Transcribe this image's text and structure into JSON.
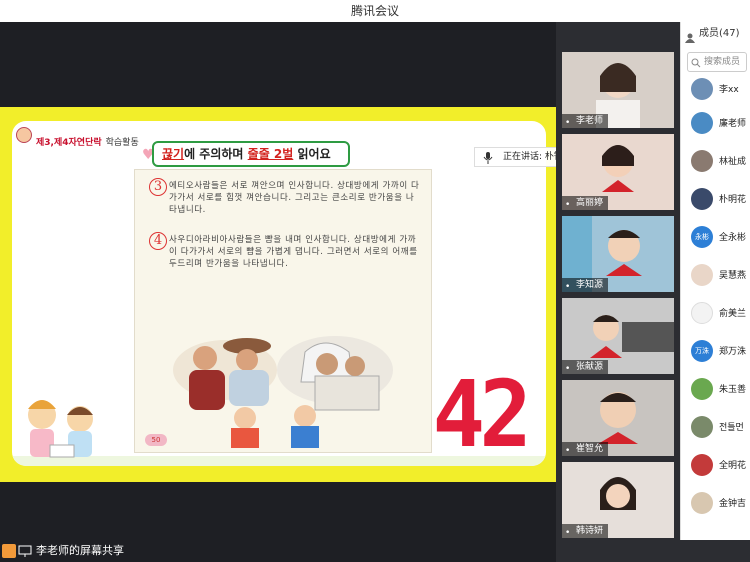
{
  "window": {
    "title": "腾讯会议"
  },
  "slide": {
    "lesson_badge": "제3,제4자연단락",
    "lesson_sub": "학습활동",
    "instruction_red1": "끊기",
    "instruction_mid": "에 주의하며 ",
    "instruction_red2": "줄줄 2벌",
    "instruction_end": " 읽어요",
    "para3_num": "3",
    "para3_text": "에티오사람들은 서로 껴안으며 인사합니다. 상대방에게 가까이 다가가서 서로를 힘껏 껴안습니다. 그리고는 큰소리로 반가움을 나타냅니다.",
    "para4_num": "4",
    "para4_text": "사우디아라비아사람들은 뺨을 내며 인사합니다. 상대방에게 가까이 다가가서 서로의 뺨을 가볍게 댑니다. 그러면서 서로의 어깨를 두드리며 반가움을 나타냅니다.",
    "page_number": "50",
    "timer": "42"
  },
  "speaking": {
    "label": "正在讲话: 朴智银、崔智允"
  },
  "video_tiles": [
    {
      "name": "李老师",
      "bg": "#d7cfc8"
    },
    {
      "name": "高丽婷",
      "bg": "#e9d8cf"
    },
    {
      "name": "李知源",
      "bg": "#9fc4d8"
    },
    {
      "name": "张献源",
      "bg": "#c9c9c9"
    },
    {
      "name": "崔智允",
      "bg": "#c8c4c0"
    },
    {
      "name": "韩诗妍",
      "bg": "#e6dfda"
    }
  ],
  "sidebar": {
    "header": "成员(47)",
    "search_placeholder": "搜索成员",
    "members": [
      {
        "name": "李xx",
        "color": "#6d8fb5",
        "initial": ""
      },
      {
        "name": "廉老师",
        "color": "#4a8bc4",
        "initial": ""
      },
      {
        "name": "林祉成",
        "color": "#8a7a70",
        "initial": ""
      },
      {
        "name": "朴明花",
        "color": "#3a4a6a",
        "initial": ""
      },
      {
        "name": "全永彬",
        "color": "#2d7fd6",
        "initial": "永彬"
      },
      {
        "name": "吴慧燕",
        "color": "#e9d6c8",
        "initial": ""
      },
      {
        "name": "俞美兰",
        "color": "#f3f3f3",
        "initial": ""
      },
      {
        "name": "郑万洙",
        "color": "#2d7fd6",
        "initial": "万洙"
      },
      {
        "name": "朱玉善",
        "color": "#6aa84f",
        "initial": ""
      },
      {
        "name": "전틀먼",
        "color": "#7a8a6a",
        "initial": ""
      },
      {
        "name": "全明花",
        "color": "#c33a3a",
        "initial": ""
      },
      {
        "name": "金钟吉",
        "color": "#d8c7b0",
        "initial": ""
      }
    ]
  },
  "bottom": {
    "share_label": "李老师的屏幕共享"
  }
}
